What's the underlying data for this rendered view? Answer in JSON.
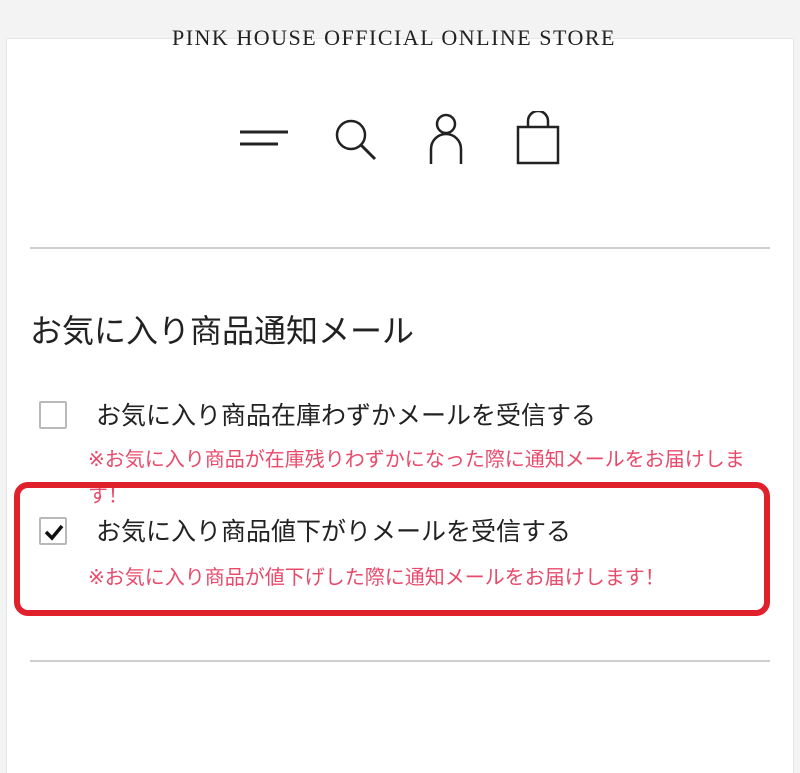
{
  "header": {
    "store_name": "PINK HOUSE OFFICIAL ONLINE STORE",
    "icons": [
      "menu-icon",
      "search-icon",
      "account-icon",
      "cart-icon"
    ]
  },
  "section": {
    "title": "お気に入り商品通知メール"
  },
  "options": [
    {
      "label": "お気に入り商品在庫わずかメールを受信する",
      "note": "※お気に入り商品が在庫残りわずかになった際に通知メールをお届けします！",
      "checked": false
    },
    {
      "label": "お気に入り商品値下がりメールを受信する",
      "note": "※お気に入り商品が値下げした際に通知メールをお届けします！",
      "checked": true
    }
  ],
  "colors": {
    "note": "#e84a6b",
    "highlight": "#e0202a",
    "text": "#222222"
  }
}
